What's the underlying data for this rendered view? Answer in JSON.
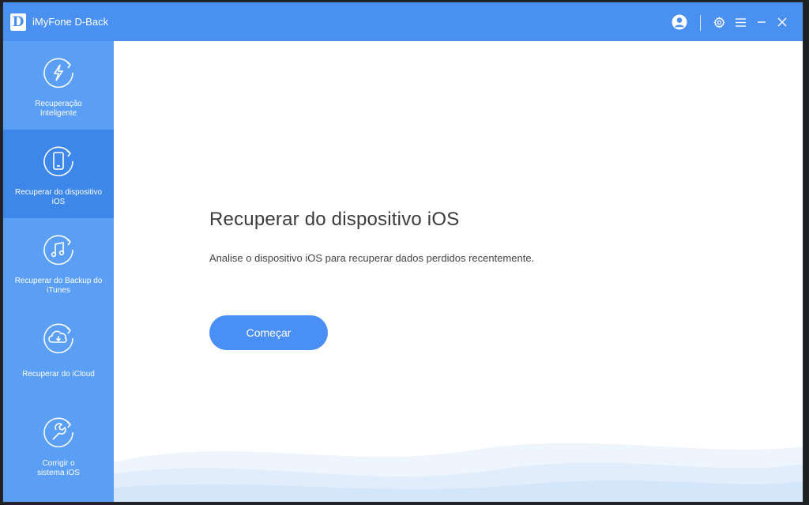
{
  "titlebar": {
    "logo_letter": "D",
    "app_title": "iMyFone D-Back",
    "icons": [
      "user-icon",
      "gear-icon",
      "menu-icon",
      "minimize-icon",
      "close-icon"
    ],
    "accent": "#4a90f0"
  },
  "sidebar": {
    "items": [
      {
        "label": "Recuperação\nInteligente",
        "icon": "lightning-refresh-icon",
        "active": false
      },
      {
        "label": "Recuperar do dispositivo\niOS",
        "icon": "phone-refresh-icon",
        "active": true
      },
      {
        "label": "Recuperar do Backup do\niTunes",
        "icon": "music-refresh-icon",
        "active": false
      },
      {
        "label": "Recuperar do iCloud",
        "icon": "cloud-refresh-icon",
        "active": false
      },
      {
        "label": "Corrigir o\nsistema iOS",
        "icon": "wrench-refresh-icon",
        "active": false
      }
    ],
    "bg": "#5a9ff5",
    "active_bg": "#3d86ea"
  },
  "main": {
    "title": "Recuperar do dispositivo iOS",
    "description": "Analise o dispositivo iOS para recuperar dados perdidos recentemente.",
    "start_button": "Começar",
    "button_color": "#4a8ff5"
  }
}
